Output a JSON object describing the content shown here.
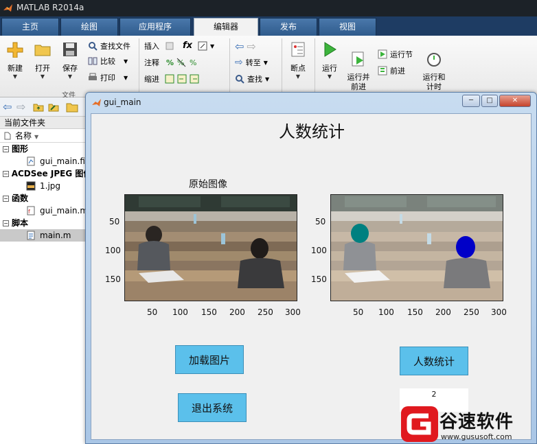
{
  "app": {
    "title": "MATLAB R2014a"
  },
  "tabs": [
    {
      "label": "主页"
    },
    {
      "label": "绘图"
    },
    {
      "label": "应用程序"
    },
    {
      "label": "编辑器"
    },
    {
      "label": "发布"
    },
    {
      "label": "视图"
    }
  ],
  "ribbon": {
    "new_label": "新建",
    "open_label": "打开",
    "save_label": "保存",
    "find_files": "查找文件",
    "compare": "比较",
    "print": "打印",
    "file_group": "文件",
    "insert": "插入",
    "comment": "注释",
    "indent": "缩进",
    "fx": "fx",
    "goto": "转至",
    "find": "查找",
    "breakpoint": "断点",
    "run": "运行",
    "run_advance": "运行并\n前进",
    "run_section": "运行节",
    "advance": "前进",
    "run_time": "运行和\n计时"
  },
  "current_folder": {
    "header": "当前文件夹",
    "name_col": "名称",
    "groups": [
      {
        "label": "图形",
        "files": [
          {
            "name": "gui_main.fig"
          }
        ]
      },
      {
        "label": "ACDSee JPEG 图像",
        "files": [
          {
            "name": "1.jpg"
          }
        ]
      },
      {
        "label": "函数",
        "files": [
          {
            "name": "gui_main.m"
          }
        ]
      },
      {
        "label": "脚本",
        "files": [
          {
            "name": "main.m"
          }
        ]
      }
    ]
  },
  "gui": {
    "window_title": "gui_main",
    "title": "人数统计",
    "axes1_title": "原始图像",
    "x_ticks": [
      "50",
      "100",
      "150",
      "200",
      "250",
      "300"
    ],
    "y_ticks": [
      "50",
      "100",
      "150"
    ],
    "load_button": "加载图片",
    "count_button": "人数统计",
    "exit_button": "退出系统",
    "count_value": "2"
  },
  "watermark": {
    "brand": "谷速软件",
    "url": "www.gususoft.com"
  },
  "colors": {
    "button": "#5bc0eb",
    "tab_bar": "#1e3c63",
    "head_cyan": "#008080",
    "head_blue": "#0000c8"
  }
}
